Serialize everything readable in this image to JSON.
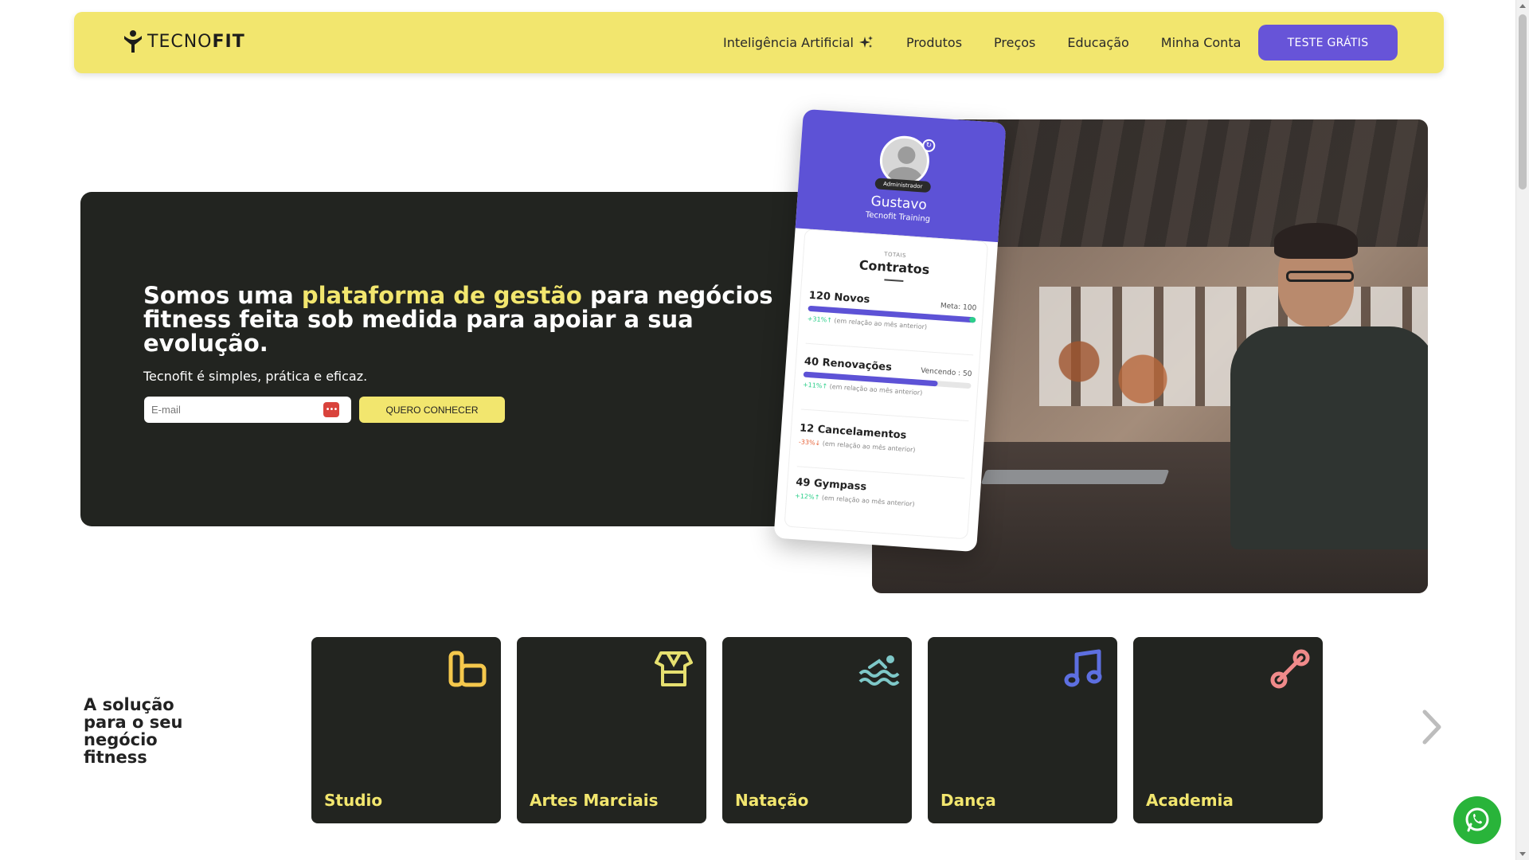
{
  "brand": {
    "logo_text_light": "TECNO",
    "logo_text_bold": "FIT"
  },
  "nav": {
    "items": [
      "Inteligência Artificial",
      "Produtos",
      "Preços",
      "Educação",
      "Minha Conta"
    ],
    "cta_label": "TESTE GRÁTIS"
  },
  "hero": {
    "title_part1": "Somos uma ",
    "title_highlight": "plataforma de gestão",
    "title_part2": " para negócios fitness feita sob medida para apoiar a sua evolução.",
    "subtitle": "Tecnofit é simples, prática e eficaz.",
    "email_placeholder": "E-mail",
    "button_label": "QUERO CONHECER"
  },
  "phone_card": {
    "role_badge": "Administrador",
    "user_name": "Gustavo",
    "user_org": "Tecnofit Training",
    "totals_label": "TOTAIS",
    "section_title": "Contratos",
    "stats": [
      {
        "label": "120 Novos",
        "meta": "Meta: 100",
        "change": "+31%↑",
        "note": "(em relação ao mês anterior)",
        "trend": "up",
        "bar_fill": 1.0
      },
      {
        "label": "40 Renovações",
        "meta": "Vencendo : 50",
        "change": "+11%↑",
        "note": "(em relação ao mês anterior)",
        "trend": "up",
        "bar_fill": 0.8
      },
      {
        "label": "12 Cancelamentos",
        "meta": "",
        "change": "-33%↓",
        "note": "(em relação ao mês anterior)",
        "trend": "down"
      },
      {
        "label": "49 Gympass",
        "meta": "",
        "change": "+12%↑",
        "note": "(em relação ao mês anterior)",
        "trend": "up"
      }
    ]
  },
  "solutions": {
    "title": "A solução para o seu negócio fitness",
    "cards": [
      {
        "label": "Studio",
        "icon": "studio-icon",
        "color": "#f5c84c"
      },
      {
        "label": "Artes Marciais",
        "icon": "martial-arts-icon",
        "color": "#e6e070"
      },
      {
        "label": "Natação",
        "icon": "swimming-icon",
        "color": "#7ec8c8"
      },
      {
        "label": "Dança",
        "icon": "music-note-icon",
        "color": "#5d6fe0"
      },
      {
        "label": "Academia",
        "icon": "dumbbell-icon",
        "color": "#f08a8a"
      }
    ]
  },
  "colors": {
    "accent_yellow": "#f2e66e",
    "accent_purple": "#6754d8",
    "dark": "#222420",
    "whatsapp_green": "#29b43a"
  }
}
